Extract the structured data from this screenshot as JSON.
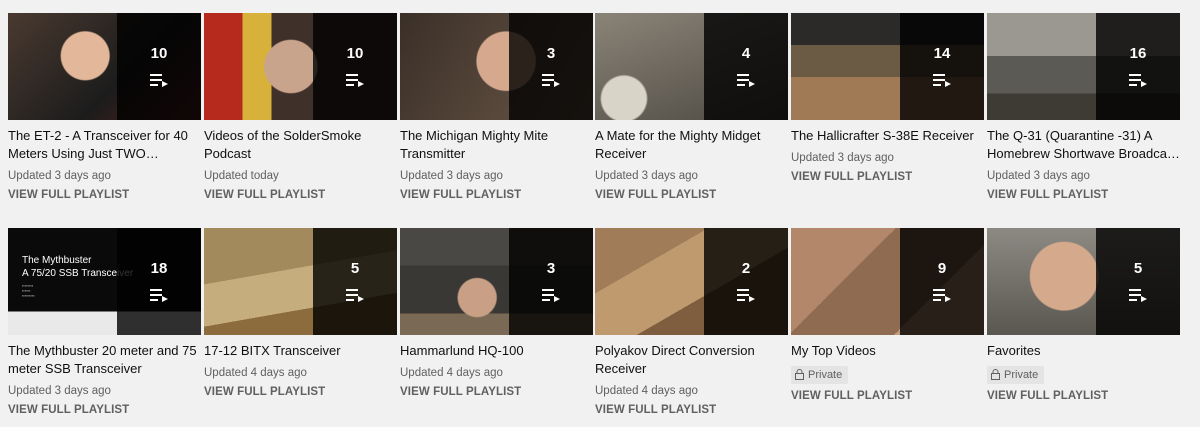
{
  "view_full_label": "VIEW FULL PLAYLIST",
  "playlists": [
    {
      "title": "The ET-2 - A Transceiver for 40 Meters Using Just TWO…",
      "count": "10",
      "updated": "Updated 3 days ago"
    },
    {
      "title": "Videos of the SolderSmoke Podcast",
      "count": "10",
      "updated": "Updated today"
    },
    {
      "title": "The Michigan Mighty Mite Transmitter",
      "count": "3",
      "updated": "Updated 3 days ago"
    },
    {
      "title": "A Mate for the Mighty Midget Receiver",
      "count": "4",
      "updated": "Updated 3 days ago"
    },
    {
      "title": "The Hallicrafter S-38E Receiver",
      "count": "14",
      "updated": "Updated 3 days ago"
    },
    {
      "title": "The Q-31 (Quarantine -31) A Homebrew Shortwave Broadca…",
      "count": "16",
      "updated": "Updated 3 days ago"
    },
    {
      "title": "The Mythbuster 20 meter and 75 meter SSB Transceiver",
      "count": "18",
      "updated": "Updated 3 days ago",
      "thumb_text_1": "The Mythbuster",
      "thumb_text_2": "A 75/20 SSB Transceiver"
    },
    {
      "title": "17-12 BITX Transceiver",
      "count": "5",
      "updated": "Updated 4 days ago"
    },
    {
      "title": "Hammarlund HQ-100",
      "count": "3",
      "updated": "Updated 4 days ago"
    },
    {
      "title": "Polyakov Direct Conversion Receiver",
      "count": "2",
      "updated": "Updated 4 days ago"
    },
    {
      "title": "My Top Videos",
      "count": "9",
      "privacy": "Private"
    },
    {
      "title": "Favorites",
      "count": "5",
      "privacy": "Private"
    }
  ]
}
